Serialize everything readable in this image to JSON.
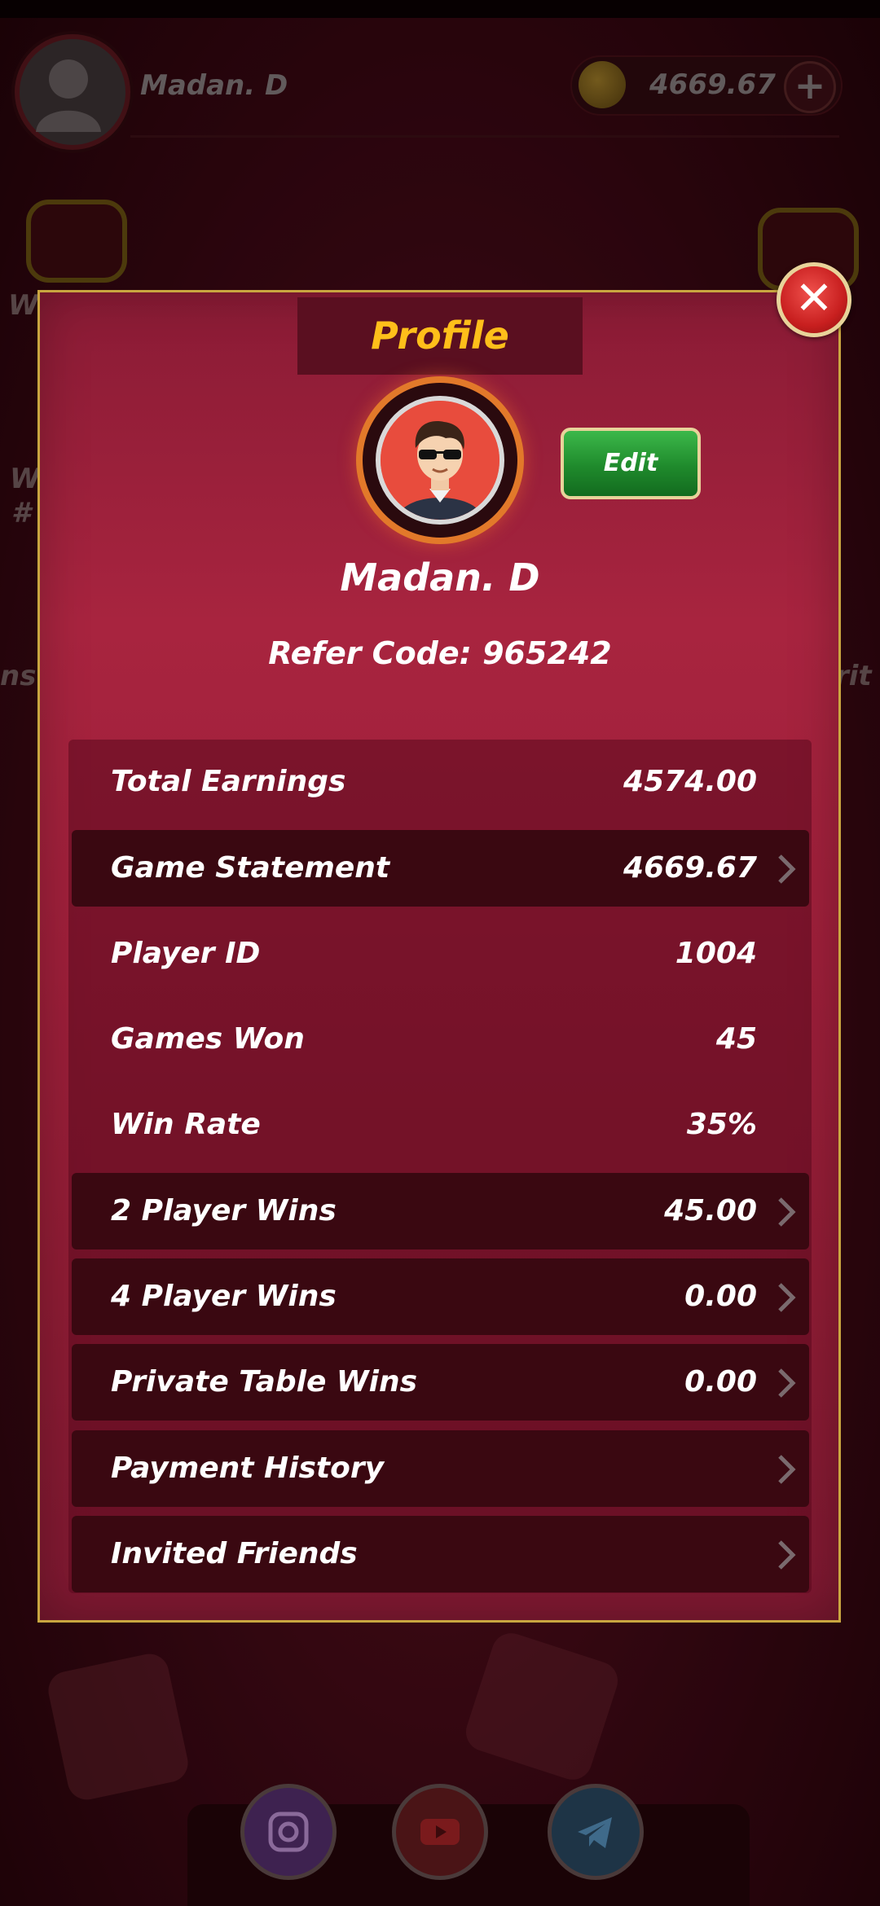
{
  "header": {
    "user_name": "Madan. D",
    "coin_balance": "4669.67",
    "add_coins_glyph": "+",
    "bg_left_label": "W",
    "bg_left_label2": "W",
    "bg_left_side": "ns",
    "bg_right_side": "rit",
    "bg_hash": "#"
  },
  "modal": {
    "title": "Profile",
    "close_glyph": "✕",
    "edit_label": "Edit",
    "player_name": "Madan. D",
    "refer_code": "Refer Code: 965242",
    "stats": [
      {
        "label": "Total Earnings",
        "value": "4574.00",
        "highlighted": false,
        "has_chevron": false
      },
      {
        "label": "Game Statement",
        "value": "4669.67",
        "highlighted": true,
        "has_chevron": true
      },
      {
        "label": "Player ID",
        "value": "1004",
        "highlighted": false,
        "has_chevron": false
      },
      {
        "label": "Games Won",
        "value": "45",
        "highlighted": false,
        "has_chevron": false
      },
      {
        "label": "Win Rate",
        "value": "35%",
        "highlighted": false,
        "has_chevron": false
      },
      {
        "label": "2 Player Wins",
        "value": "45.00",
        "highlighted": true,
        "has_chevron": true
      },
      {
        "label": "4 Player Wins",
        "value": "0.00",
        "highlighted": true,
        "has_chevron": true
      },
      {
        "label": "Private Table Wins",
        "value": "0.00",
        "highlighted": true,
        "has_chevron": true
      },
      {
        "label": "Payment History",
        "value": "",
        "highlighted": true,
        "has_chevron": true
      },
      {
        "label": "Invited Friends",
        "value": "",
        "highlighted": true,
        "has_chevron": true
      }
    ]
  },
  "social": [
    {
      "name": "instagram",
      "icon": "instagram-icon",
      "color": "#7a4aa8"
    },
    {
      "name": "youtube",
      "icon": "youtube-icon",
      "color": "#c42323"
    },
    {
      "name": "telegram",
      "icon": "telegram-icon",
      "color": "#1e7fc1"
    }
  ],
  "colors": {
    "accent_gold": "#ffbf1a",
    "modal_border": "#c9a640",
    "edit_green": "#1f8a2c",
    "close_red": "#c81f1f"
  }
}
